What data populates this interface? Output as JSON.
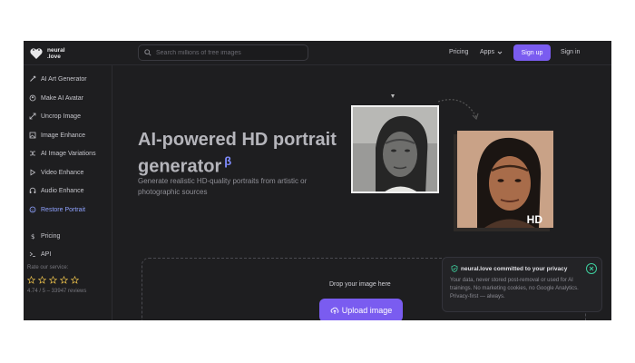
{
  "header": {
    "logo_line1": "neural",
    "logo_line2": ".love",
    "search_placeholder": "Search millions of free images",
    "nav_pricing": "Pricing",
    "nav_apps": "Apps",
    "signup_label": "Sign up",
    "signin_label": "Sign in"
  },
  "sidebar": {
    "items": [
      {
        "label": "AI Art Generator",
        "icon": "brush-icon"
      },
      {
        "label": "Make AI Avatar",
        "icon": "avatar-icon"
      },
      {
        "label": "Uncrop Image",
        "icon": "expand-icon"
      },
      {
        "label": "Image Enhance",
        "icon": "image-icon"
      },
      {
        "label": "AI Image Variations",
        "icon": "shuffle-icon"
      },
      {
        "label": "Video Enhance",
        "icon": "play-icon"
      },
      {
        "label": "Audio Enhance",
        "icon": "headphones-icon"
      },
      {
        "label": "Restore Portrait",
        "icon": "face-icon",
        "active": true
      },
      {
        "label": "Pricing",
        "icon": "dollar-icon"
      },
      {
        "label": "API",
        "icon": "terminal-icon"
      }
    ],
    "rate_label": "Rate our service:",
    "stars": 5,
    "reviews": "4.74 / 5 – 33947 reviews"
  },
  "hero": {
    "title": "AI-powered HD portrait generator",
    "beta": "β",
    "subtitle": "Generate realistic HD-quality portraits from artistic or photographic sources",
    "hd_label": "HD"
  },
  "dropzone": {
    "text": "Drop your image here",
    "upload_label": "Upload image"
  },
  "privacy": {
    "title": "neural.love committed to your privacy",
    "body": "Your data, never stored post-removal or used for AI trainings. No marketing cookies, no Google Analytics. Privacy-first — always."
  },
  "colors": {
    "accent": "#7a5cf0",
    "active_link": "#8fa2ff",
    "privacy_green": "#3ecf9e",
    "background": "#1e1e20"
  }
}
